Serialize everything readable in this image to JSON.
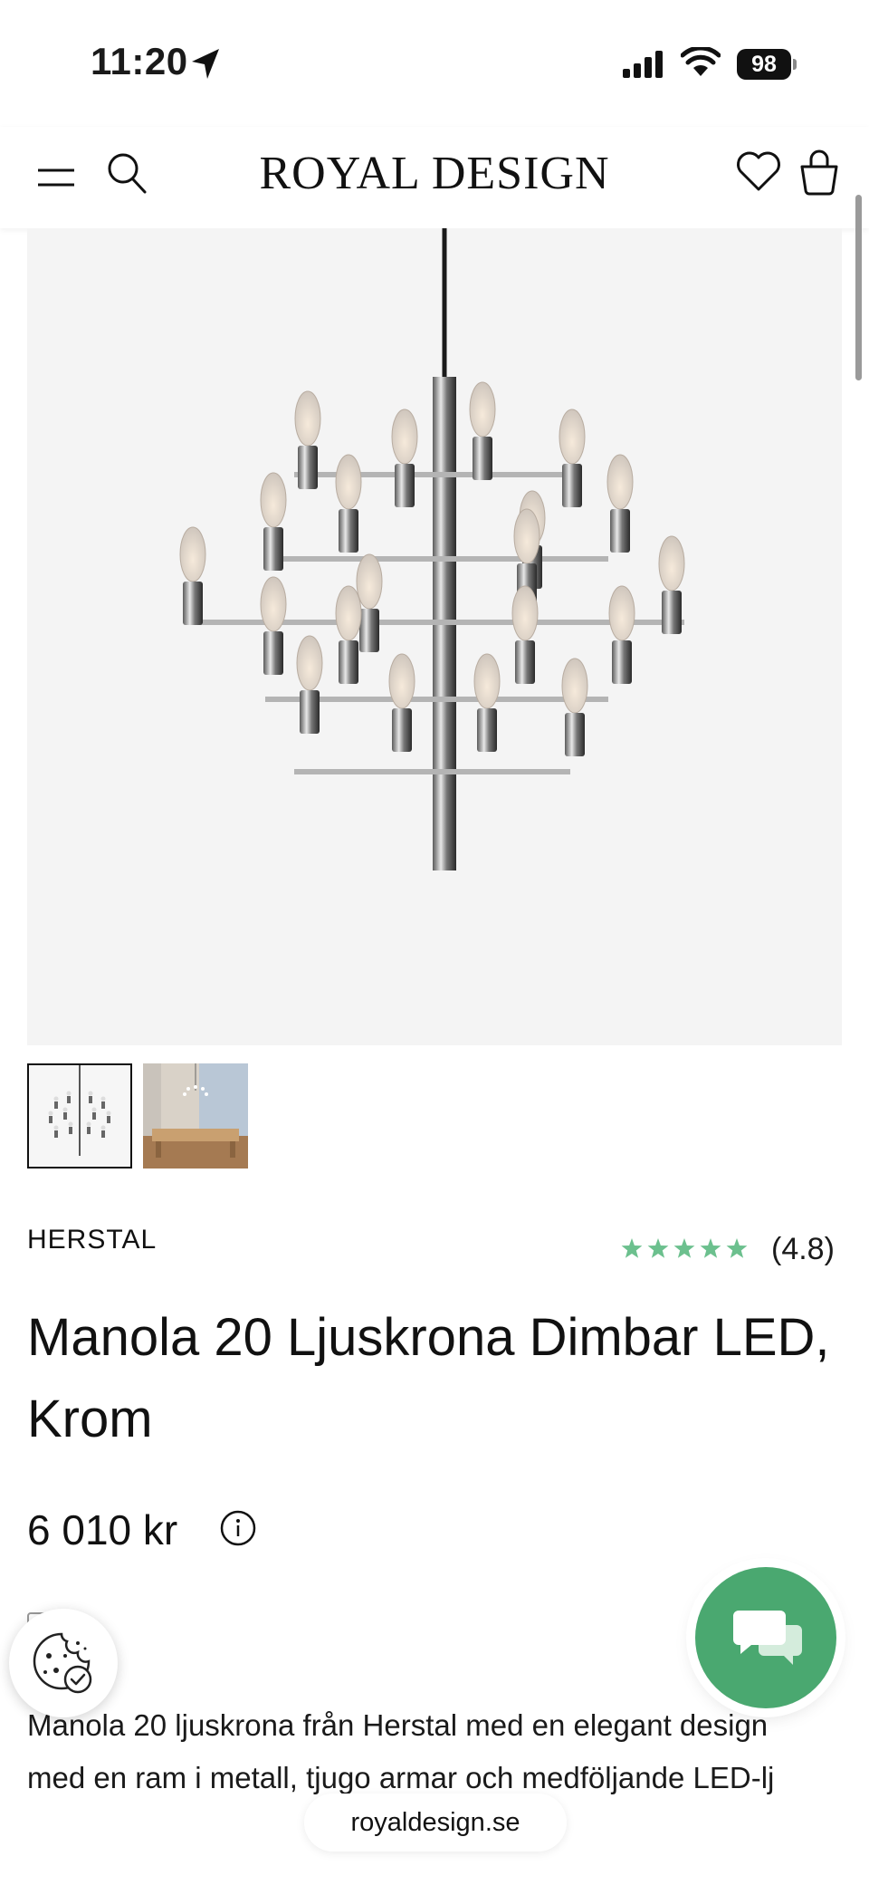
{
  "status_bar": {
    "time": "11:20",
    "battery": "98"
  },
  "header": {
    "logo": "ROYAL DESIGN"
  },
  "product": {
    "brand": "HERSTAL",
    "rating": "(4.8)",
    "rating_value": 4.8,
    "title": "Manola 20 Ljuskrona Dimbar LED, Krom",
    "price": "6 010 kr",
    "description": "Manola 20 ljuskrona från Herstal med en elegant design med en ram i metall, tjugo armar och medföljande LED-lj"
  },
  "browser": {
    "url": "royaldesign.se"
  },
  "colors": {
    "accent_green": "#4aa870",
    "star_green": "#6cc08e",
    "background": "#ffffff",
    "image_bg": "#f4f4f4"
  },
  "icons": [
    "location-arrow-icon",
    "signal-icon",
    "wifi-icon",
    "menu-icon",
    "search-icon",
    "heart-icon",
    "bag-icon",
    "star-icon",
    "info-icon",
    "cookie-icon",
    "chat-icon"
  ]
}
